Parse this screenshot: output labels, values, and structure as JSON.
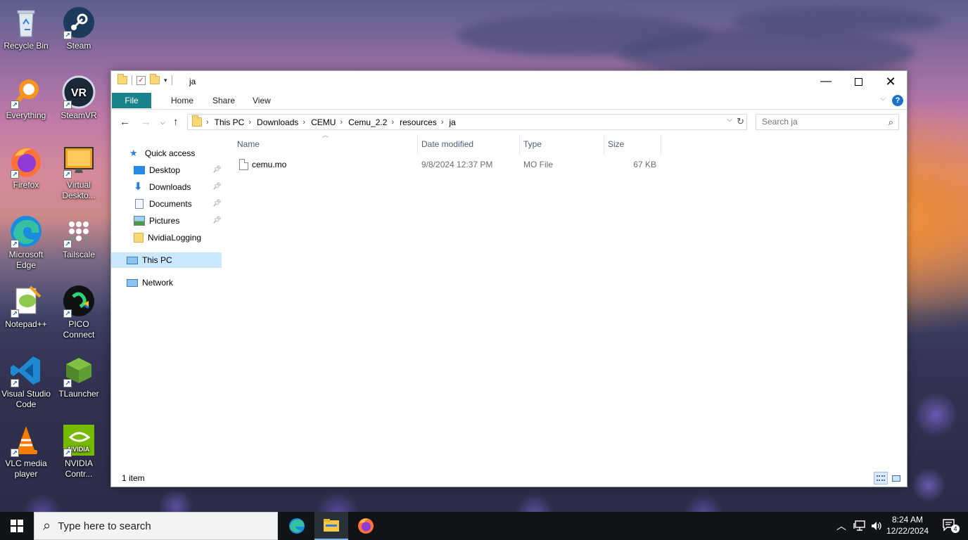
{
  "desktop": {
    "icons": [
      {
        "label": "Recycle Bin",
        "icon": "recycle-bin-icon"
      },
      {
        "label": "Steam",
        "icon": "steam-icon"
      },
      {
        "label": "Everything",
        "icon": "everything-search-icon"
      },
      {
        "label": "SteamVR",
        "icon": "steamvr-icon"
      },
      {
        "label": "Firefox",
        "icon": "firefox-icon"
      },
      {
        "label": "Virtual Deskto...",
        "icon": "virtual-desktop-icon"
      },
      {
        "label": "Microsoft Edge",
        "icon": "edge-icon"
      },
      {
        "label": "Tailscale",
        "icon": "tailscale-icon"
      },
      {
        "label": "Notepad++",
        "icon": "notepad-plus-plus-icon"
      },
      {
        "label": "PICO Connect",
        "icon": "pico-connect-icon"
      },
      {
        "label": "Visual Studio Code",
        "icon": "vscode-icon"
      },
      {
        "label": "TLauncher",
        "icon": "tlauncher-icon"
      },
      {
        "label": "VLC media player",
        "icon": "vlc-icon"
      },
      {
        "label": "NVIDIA Contr...",
        "icon": "nvidia-icon"
      }
    ]
  },
  "explorer": {
    "title": "ja",
    "ribbon_tabs": [
      "File",
      "Home",
      "Share",
      "View"
    ],
    "breadcrumb": [
      "This PC",
      "Downloads",
      "CEMU",
      "Cemu_2.2",
      "resources",
      "ja"
    ],
    "search_placeholder": "Search ja",
    "nav": {
      "quick_access": "Quick access",
      "items": [
        "Desktop",
        "Downloads",
        "Documents",
        "Pictures",
        "NvidiaLogging"
      ],
      "this_pc": "This PC",
      "network": "Network"
    },
    "columns": [
      "Name",
      "Date modified",
      "Type",
      "Size"
    ],
    "files": [
      {
        "name": "cemu.mo",
        "date": "9/8/2024 12:37 PM",
        "type": "MO File",
        "size": "67 KB"
      }
    ],
    "status": "1 item"
  },
  "taskbar": {
    "search_placeholder": "Type here to search",
    "apps": [
      "edge-icon",
      "file-explorer-icon",
      "firefox-icon"
    ],
    "time": "8:24 AM",
    "date": "12/22/2024",
    "notification_count": "4"
  }
}
